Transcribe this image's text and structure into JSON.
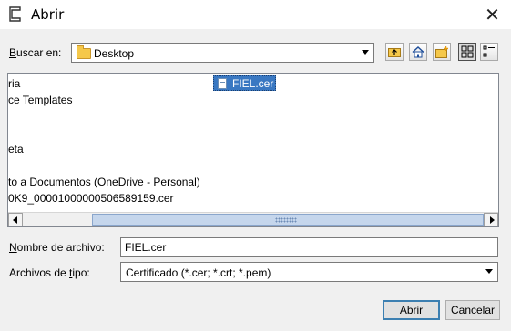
{
  "window": {
    "title": "Abrir",
    "close_glyph": "✕"
  },
  "lookin": {
    "label_pre": "",
    "label_accel": "B",
    "label_post": "uscar en:",
    "value": "Desktop"
  },
  "toolbar": [
    {
      "name": "up-folder-button",
      "icon": "folder-up-icon"
    },
    {
      "name": "home-button",
      "icon": "home-icon"
    },
    {
      "name": "new-folder-button",
      "icon": "new-folder-icon"
    },
    {
      "name": "list-view-button",
      "icon": "list-view-icon",
      "active": true
    },
    {
      "name": "details-view-button",
      "icon": "details-view-icon"
    }
  ],
  "files": [
    {
      "text": "ria"
    },
    {
      "text": "ce Templates"
    },
    {
      "text": ""
    },
    {
      "text": ""
    },
    {
      "text": "eta"
    },
    {
      "text": ""
    },
    {
      "text": "to a Documentos (OneDrive - Personal)"
    },
    {
      "text": "0K9_00001000000506589159.cer"
    }
  ],
  "selected_file": "FIEL.cer",
  "filename": {
    "label_accel": "N",
    "label_post": "ombre de archivo:",
    "value": "FIEL.cer"
  },
  "filetype": {
    "label_pre": "Archivos de ",
    "label_accel": "t",
    "label_post": "ipo:",
    "value": "Certificado (*.cer; *.crt; *.pem)"
  },
  "buttons": {
    "open": "Abrir",
    "cancel": "Cancelar"
  },
  "colors": {
    "selection": "#3a78c2",
    "default_button_border": "#3c7fb1"
  }
}
